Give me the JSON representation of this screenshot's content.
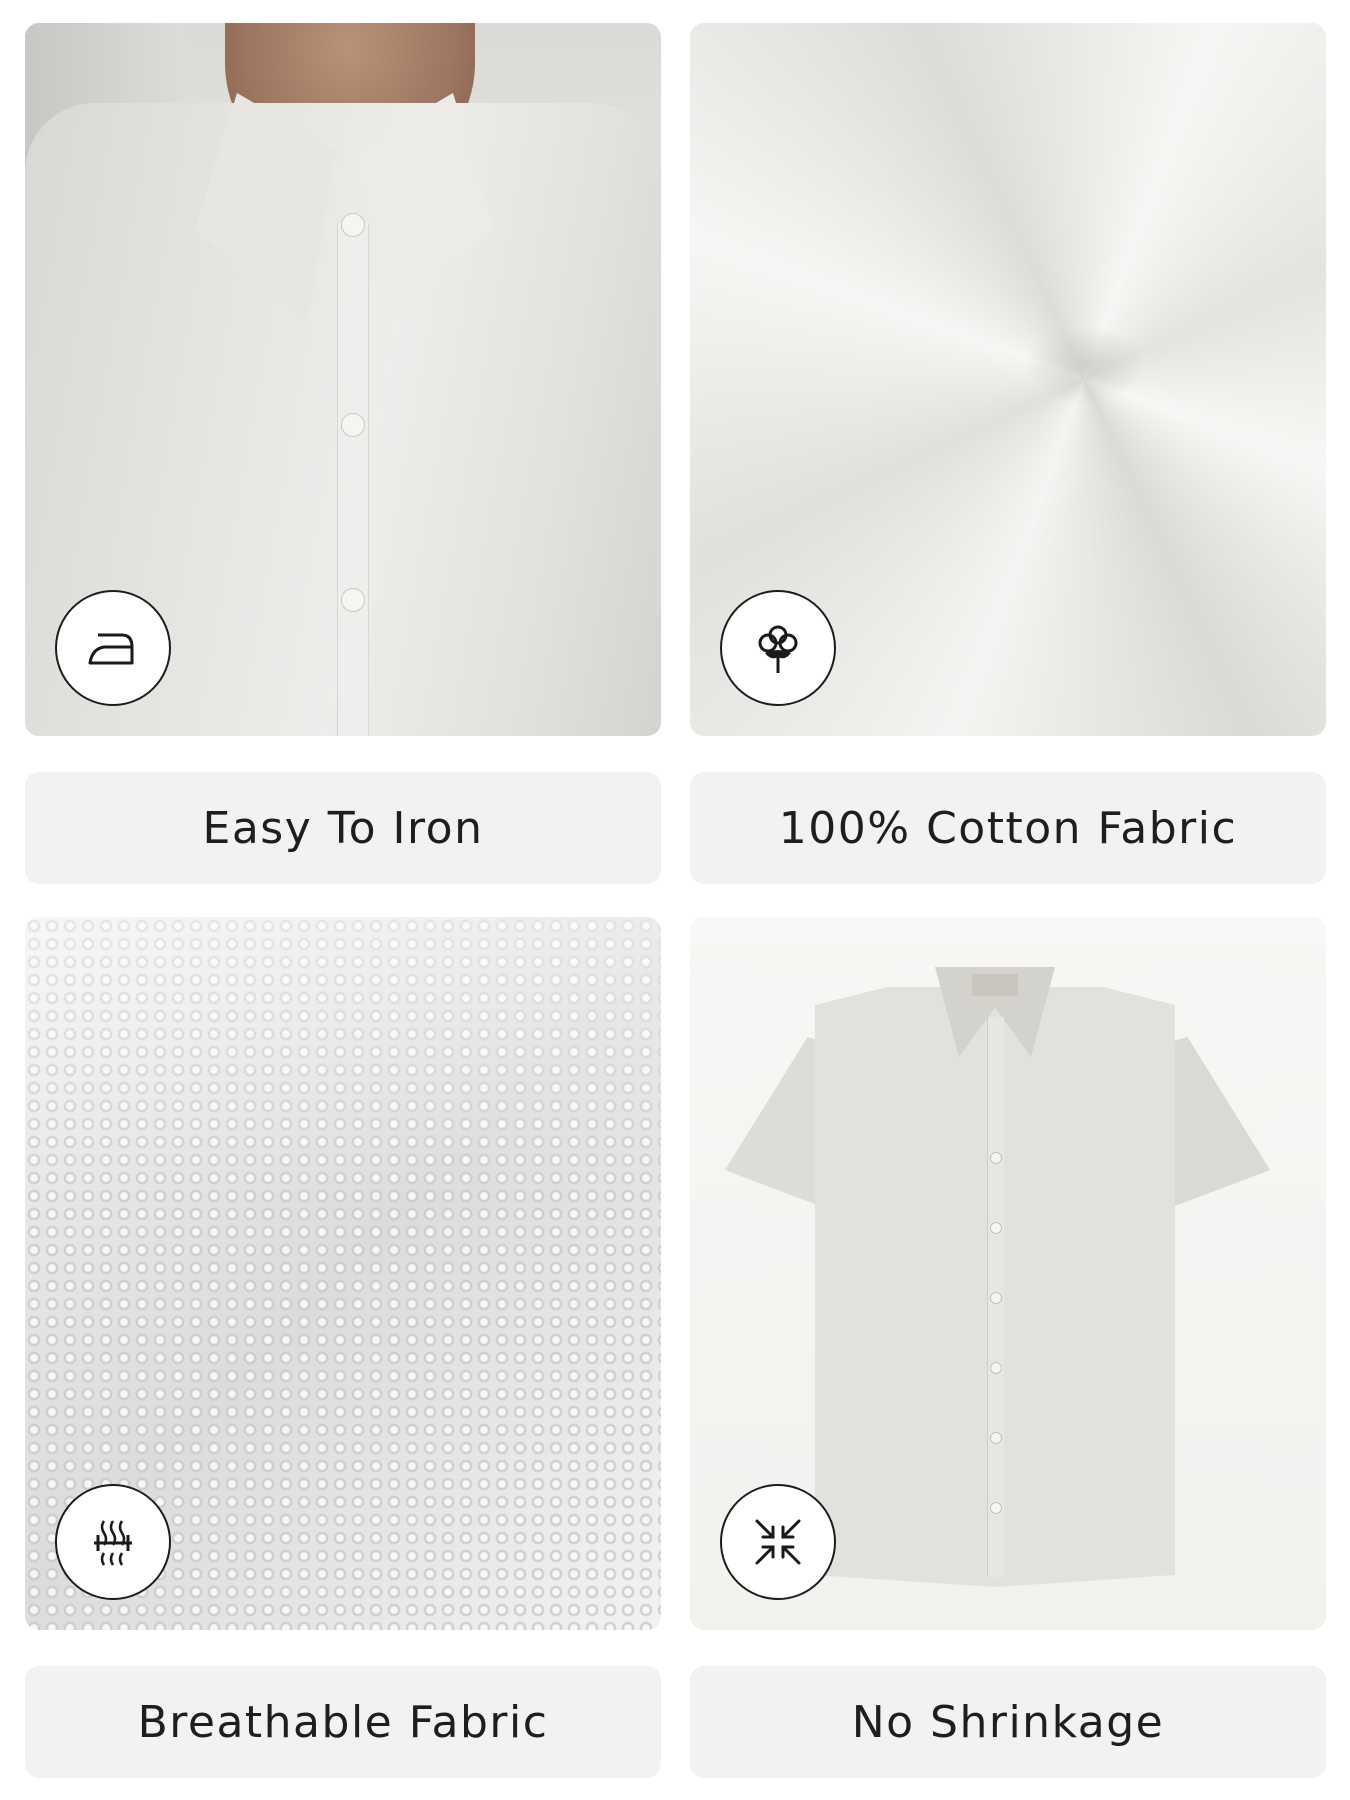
{
  "features": [
    {
      "caption": "Easy To Iron",
      "icon": "iron-icon"
    },
    {
      "caption": "100% Cotton Fabric",
      "icon": "cotton-icon"
    },
    {
      "caption": "Breathable Fabric",
      "icon": "breathable-icon"
    },
    {
      "caption": "No Shrinkage",
      "icon": "no-shrink-icon"
    }
  ],
  "colors": {
    "caption_bg": "#f3f2f1",
    "text": "#1e1e1e",
    "shirt": "#e3e1dc"
  }
}
